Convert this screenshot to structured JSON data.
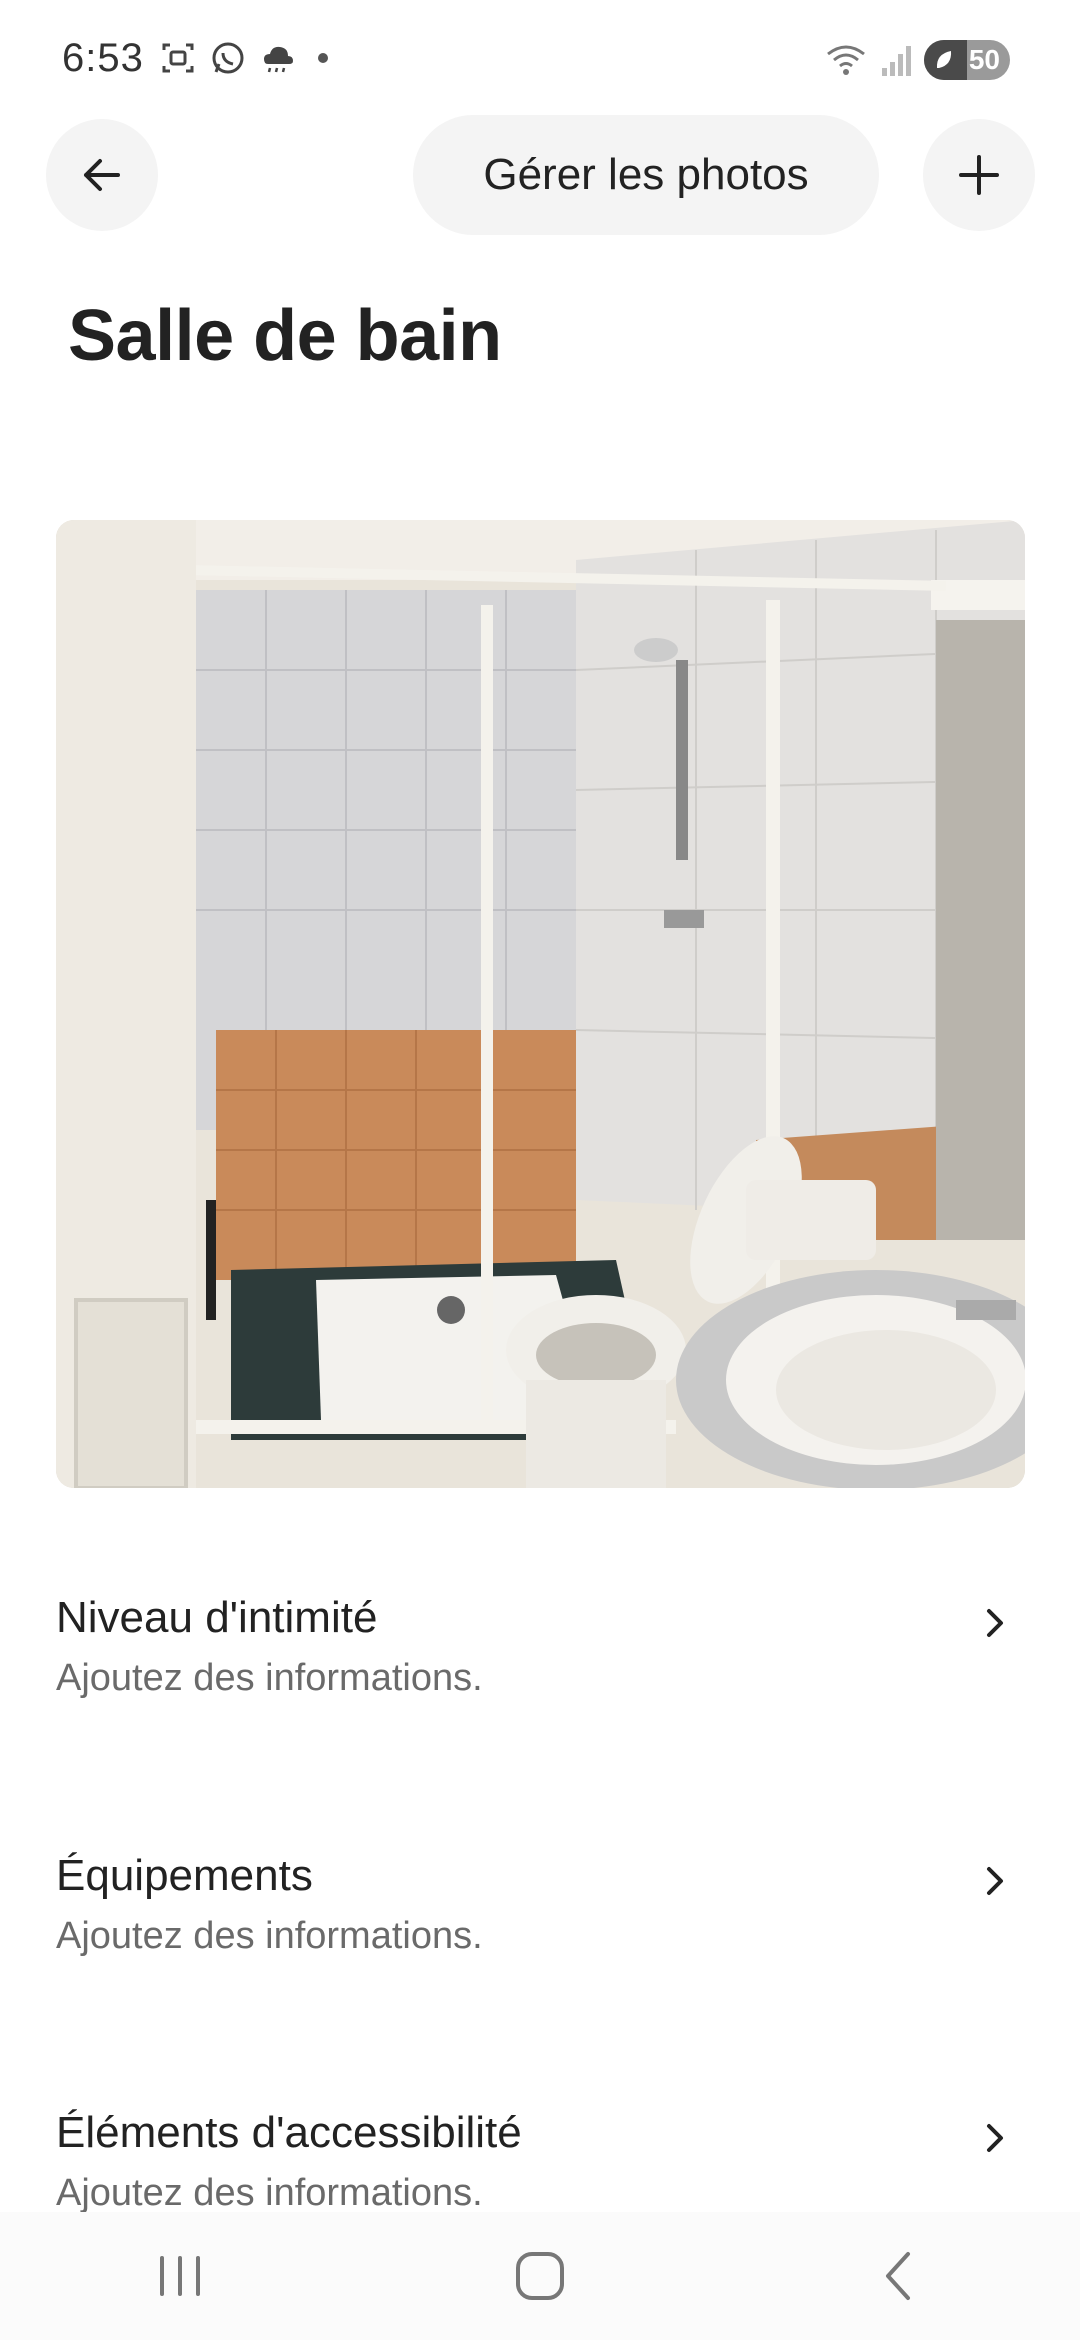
{
  "status_bar": {
    "time": "6:53",
    "battery_level": "50",
    "battery_fraction": 0.5,
    "icons_left": [
      "screenshot-icon",
      "whatsapp-icon",
      "weather-icon",
      "dot-icon"
    ],
    "icons_right": [
      "wifi-icon",
      "signal-icon",
      "battery-icon"
    ]
  },
  "header": {
    "back_icon": "arrow-left-icon",
    "manage_photos_label": "Gérer les photos",
    "add_icon": "plus-icon"
  },
  "page": {
    "title": "Salle de bain"
  },
  "photo": {
    "subject": "bathroom-photo"
  },
  "rows": [
    {
      "title": "Niveau d'intimité",
      "subtitle": "Ajoutez des informations."
    },
    {
      "title": "Équipements",
      "subtitle": "Ajoutez des informations."
    },
    {
      "title": "Éléments d'accessibilité",
      "subtitle": "Ajoutez des informations."
    }
  ],
  "nav_bar": {
    "icons": [
      "recent-apps-icon",
      "home-icon",
      "back-icon"
    ]
  },
  "colors": {
    "text_primary": "#222222",
    "text_secondary": "#6a6a6a",
    "button_bg": "#f4f4f4"
  }
}
